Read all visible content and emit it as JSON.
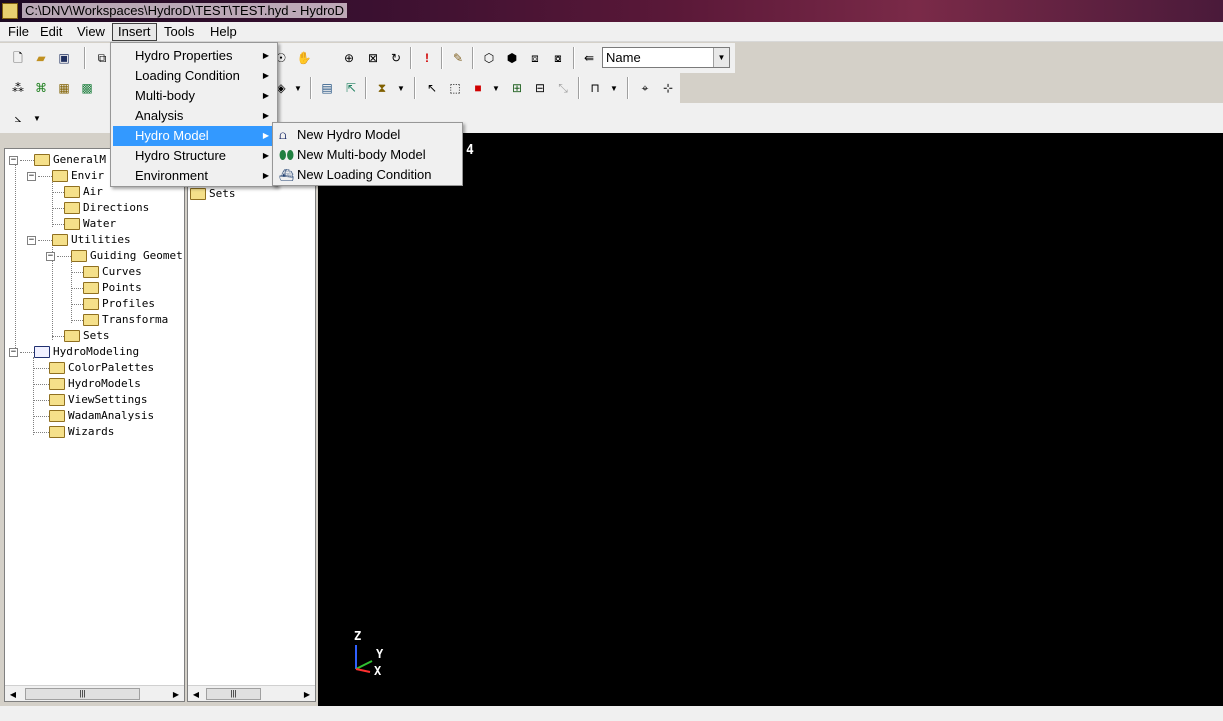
{
  "window": {
    "title": "C:\\DNV\\Workspaces\\HydroD\\TEST\\TEST.hyd - HydroD"
  },
  "menubar": {
    "file": "File",
    "edit": "Edit",
    "view": "View",
    "insert": "Insert",
    "tools": "Tools",
    "help": "Help"
  },
  "toolbar": {
    "name_select_value": "Name"
  },
  "insert_menu": {
    "items": [
      {
        "label": "Hydro Properties"
      },
      {
        "label": "Loading Condition"
      },
      {
        "label": "Multi-body"
      },
      {
        "label": "Analysis"
      },
      {
        "label": "Hydro Model"
      },
      {
        "label": "Hydro Structure"
      },
      {
        "label": "Environment"
      }
    ]
  },
  "hydro_model_submenu": {
    "items": [
      {
        "label": "New Hydro Model",
        "icon": "hydro-model-icon"
      },
      {
        "label": "New Multi-body Model",
        "icon": "multi-body-icon"
      },
      {
        "label": "New Loading Condition",
        "icon": "loading-condition-icon"
      }
    ]
  },
  "tree": {
    "nodes": [
      {
        "label": "GeneralM"
      },
      {
        "label": "Envir"
      },
      {
        "label": "Air"
      },
      {
        "label": "Directions"
      },
      {
        "label": "Water"
      },
      {
        "label": "Utilities"
      },
      {
        "label": "Guiding Geomet"
      },
      {
        "label": "Curves"
      },
      {
        "label": "Points"
      },
      {
        "label": "Profiles"
      },
      {
        "label": "Transforma"
      },
      {
        "label": "Sets"
      },
      {
        "label": "HydroModeling"
      },
      {
        "label": "ColorPalettes"
      },
      {
        "label": "HydroModels"
      },
      {
        "label": "ViewSettings"
      },
      {
        "label": "WadamAnalysis"
      },
      {
        "label": "Wizards"
      }
    ]
  },
  "mid_panel": {
    "label": "Sets"
  },
  "viewport": {
    "overlay_text": "4",
    "axis_z": "Z",
    "axis_y": "Y",
    "axis_x": "X"
  },
  "colors": {
    "highlight": "#3399ff",
    "viewport_bg": "#000000"
  }
}
